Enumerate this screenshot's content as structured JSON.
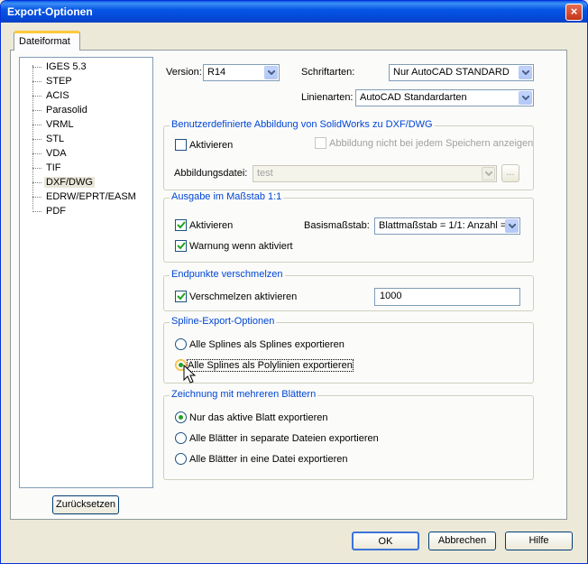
{
  "window": {
    "title": "Export-Optionen",
    "close_label": "×"
  },
  "tab": {
    "label": "Dateiformat"
  },
  "tree": {
    "items": [
      {
        "label": "IGES 5.3"
      },
      {
        "label": "STEP"
      },
      {
        "label": "ACIS"
      },
      {
        "label": "Parasolid"
      },
      {
        "label": "VRML"
      },
      {
        "label": "STL"
      },
      {
        "label": "VDA"
      },
      {
        "label": "TIF"
      },
      {
        "label": "DXF/DWG",
        "selected": true
      },
      {
        "label": "EDRW/EPRT/EASM"
      },
      {
        "label": "PDF"
      }
    ]
  },
  "reset_button": "Zurücksetzen",
  "version": {
    "label": "Version:",
    "value": "R14"
  },
  "fonts": {
    "label": "Schriftarten:",
    "value": "Nur AutoCAD STANDARD"
  },
  "linetypes": {
    "label": "Linienarten:",
    "value": "AutoCAD Standardarten"
  },
  "custom_map": {
    "title": "Benutzerdefinierte Abbildung von SolidWorks zu DXF/DWG",
    "activate": "Aktivieren",
    "no_show": "Abbildung nicht bei jedem Speichern anzeigen",
    "file_label": "Abbildungsdatei:",
    "file_value": "test",
    "browse_label": "..."
  },
  "scale": {
    "title": "Ausgabe im Maßstab 1:1",
    "activate": "Aktivieren",
    "warn": "Warnung wenn aktiviert",
    "base_label": "Basismaßstab:",
    "base_value": "Blattmaßstab = 1/1: Anzahl ="
  },
  "merge": {
    "title": "Endpunkte verschmelzen",
    "activate": "Verschmelzen aktivieren",
    "value": "1000"
  },
  "spline": {
    "title": "Spline-Export-Optionen",
    "opt1": "Alle Splines als Splines exportieren",
    "opt2": "Alle Splines als Polylinien exportieren"
  },
  "sheets": {
    "title": "Zeichnung mit mehreren Blättern",
    "opt1": "Nur das aktive Blatt exportieren",
    "opt2": "Alle Blätter in separate Dateien exportieren",
    "opt3": "Alle Blätter in eine Datei exportieren"
  },
  "footer": {
    "ok": "OK",
    "cancel": "Abbrechen",
    "help": "Hilfe"
  },
  "colors": {
    "title_bar": "#0449d6",
    "group_title": "#0046d5",
    "radio_dot": "#21a121"
  }
}
